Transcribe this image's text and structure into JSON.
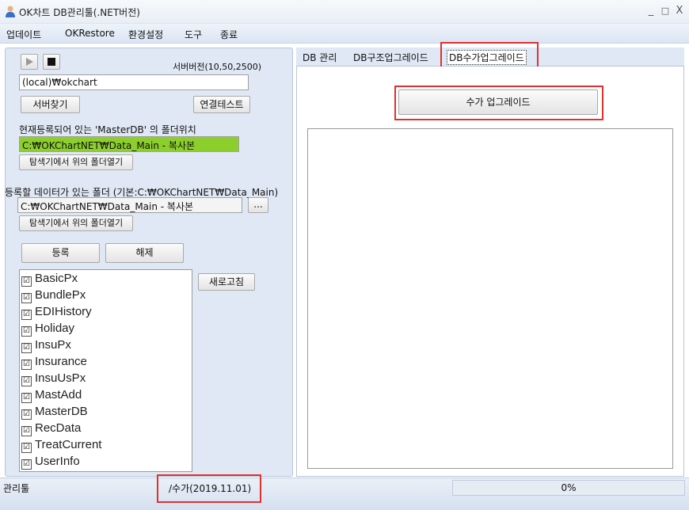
{
  "window": {
    "title": "OK차트 DB관리툴(.NET버전)",
    "minimize": "_",
    "maximize": "□",
    "close": "X"
  },
  "menu": [
    "업데이트",
    "OKRestore",
    "환경설정",
    "도구",
    "종료"
  ],
  "left": {
    "server_version": "서버버전(10,50,2500)",
    "server_name": "(local)₩okchart",
    "find_server": "서버찾기",
    "test_connection": "연결테스트",
    "master_db_label": "현재등록되어 있는 'MasterDB' 의 폴더위치",
    "master_db_path": "C:₩OKChartNET₩Data_Main - 복사본",
    "open_folder": "탐색기에서 위의 폴더열기",
    "data_folder_label": "등록할 데이터가 있는 폴더 (기본:C:₩OKChartNET₩Data_Main)",
    "data_folder_path": "C:₩OKChartNET₩Data_Main - 복사본",
    "browse": "...",
    "open_folder2": "탐색기에서 위의 폴더열기",
    "register": "등록",
    "unregister": "해제",
    "refresh": "새로고침",
    "databases": [
      "BasicPx",
      "BundlePx",
      "EDIHistory",
      "Holiday",
      "InsuPx",
      "Insurance",
      "InsuUsPx",
      "MastAdd",
      "MasterDB",
      "RecData",
      "TreatCurrent",
      "UserInfo"
    ],
    "checkmark": "☑"
  },
  "tabs": [
    "DB 관리",
    "DB구조업그레이드",
    "DB수가업그레이드"
  ],
  "tab_page": {
    "upgrade_button": "수가 업그레이드"
  },
  "status": {
    "left": "관리툴",
    "version": "/수가(2019.11.01)",
    "progress": "0%",
    "progress_value": 0
  }
}
